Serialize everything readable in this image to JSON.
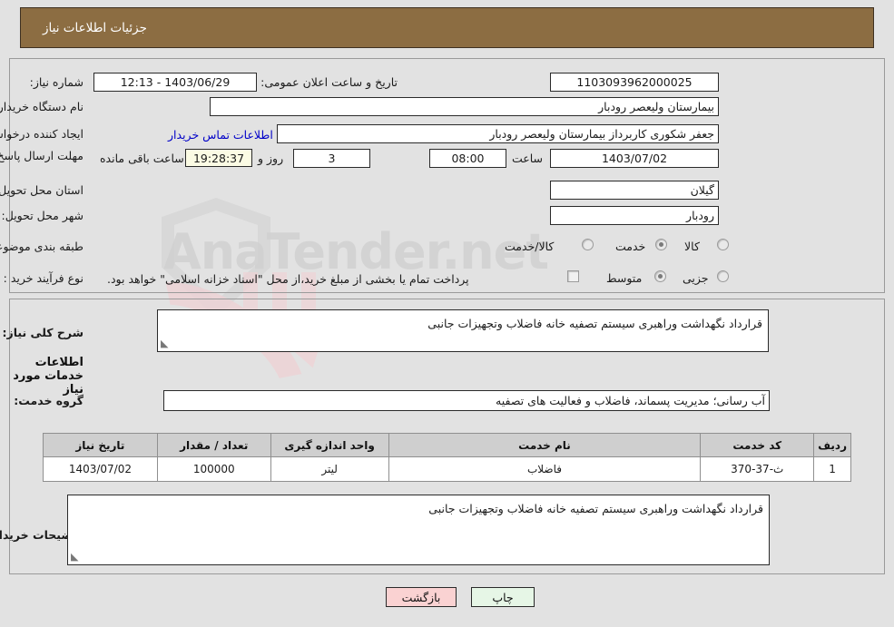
{
  "header": {
    "title": "جزئیات اطلاعات نیاز",
    "bg_color": "#8c6d42",
    "text_color": "#ffffff"
  },
  "form": {
    "need_number": {
      "label": "شماره نیاز:",
      "value": "1103093962000025"
    },
    "announce_datetime": {
      "label": "تاریخ و ساعت اعلان عمومی:",
      "value": "1403/06/29 - 12:13"
    },
    "buyer_org": {
      "label": "نام دستگاه خریدار:",
      "value": "بیمارستان ولیعصر رودبار"
    },
    "requester": {
      "label": "ایجاد کننده درخواست:",
      "value": "جعفر شکوری کاربرداز بیمارستان ولیعصر رودبار"
    },
    "buyer_contact_link": {
      "label": "اطلاعات تماس خریدار",
      "color": "#0000c8"
    },
    "deadline": {
      "label": "مهلت ارسال پاسخ: تا تاریخ:",
      "date": "1403/07/02",
      "hour_label": "ساعت",
      "hour": "08:00",
      "days_remaining": "3",
      "days_label": "روز و",
      "time_remaining": "19:28:37",
      "time_remaining_label": "ساعت باقی مانده"
    },
    "delivery_province": {
      "label": "استان محل تحویل:",
      "value": "گیلان"
    },
    "delivery_city": {
      "label": "شهر محل تحویل:",
      "value": "رودبار"
    },
    "subject_category": {
      "label": "طبقه بندی موضوعی:",
      "options": [
        {
          "label": "کالا",
          "selected": false
        },
        {
          "label": "خدمت",
          "selected": true
        },
        {
          "label": "کالا/خدمت",
          "selected": false
        }
      ]
    },
    "purchase_process": {
      "label": "نوع فرآیند خرید :",
      "options": [
        {
          "label": "جزیی",
          "selected": false
        },
        {
          "label": "متوسط",
          "selected": true
        }
      ],
      "treasury_checkbox": {
        "checked": false,
        "label": "پرداخت تمام یا بخشی از مبلغ خرید،از محل \"اسناد خزانه اسلامی\" خواهد بود."
      }
    },
    "general_description": {
      "label": "شرح کلی نیاز:",
      "value": "قرارداد نگهداشت وراهبری سیستم تصفیه خانه فاضلاب وتجهیزات جانبی"
    },
    "services_section_title": "اطلاعات خدمات مورد نیاز",
    "service_group": {
      "label": "گروه خدمت:",
      "value": "آب رسانی؛ مدیریت پسماند، فاضلاب و فعالیت های تصفیه"
    },
    "buyer_notes": {
      "label": "توضیحات خریدار:",
      "value": "قرارداد نگهداشت وراهبری سیستم تصفیه خانه فاضلاب وتجهیزات جانبی"
    }
  },
  "items_table": {
    "columns": [
      "ردیف",
      "کد خدمت",
      "نام خدمت",
      "واحد اندازه گیری",
      "تعداد / مقدار",
      "تاریخ نیاز"
    ],
    "rows": [
      {
        "row_no": "1",
        "service_code": "ث-37-370",
        "service_name": "فاضلاب",
        "unit": "لیتر",
        "quantity": "100000",
        "need_date": "1403/07/02"
      }
    ]
  },
  "footer": {
    "print_label": "چاپ",
    "back_label": "بازگشت",
    "print_bg": "#e6f6e6",
    "back_bg": "#fad2d2"
  },
  "watermark": {
    "text": "AnaTender.net"
  }
}
